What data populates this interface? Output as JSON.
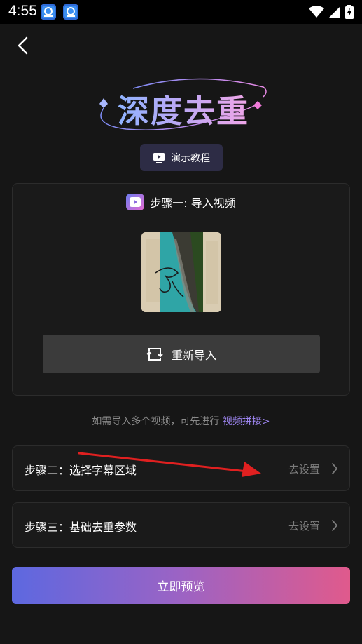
{
  "status_bar": {
    "time": "4:55"
  },
  "header": {
    "title": "深度去重",
    "tutorial_label": "演示教程"
  },
  "step1": {
    "label": "步骤一: 导入视频",
    "reimport_label": "重新导入"
  },
  "hint": {
    "text": "如需导入多个视频，可先进行",
    "link": "视频拼接>"
  },
  "step2": {
    "label": "步骤二：选择字幕区域",
    "action": "去设置"
  },
  "step3": {
    "label": "步骤三：基础去重参数",
    "action": "去设置"
  },
  "preview": {
    "label": "立即预览"
  },
  "colors": {
    "background": "#161616",
    "accent_start": "#5d68e0",
    "accent_end": "#e05a8c",
    "link": "#9e86f2",
    "annotation": "#e02020"
  },
  "icons": [
    "back-icon",
    "play-screen-icon",
    "video-icon",
    "refresh-icon",
    "chevron-right-icon",
    "wifi-icon",
    "signal-icon",
    "battery-icon"
  ]
}
